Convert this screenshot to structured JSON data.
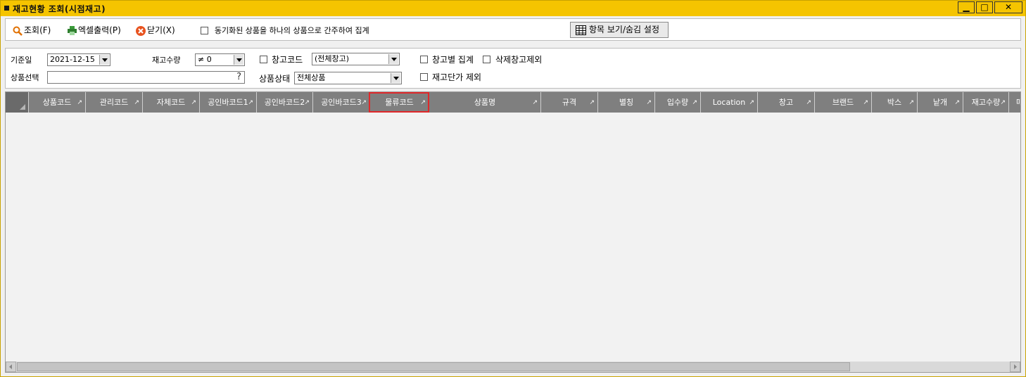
{
  "window": {
    "title": "재고현황 조회(시점재고)",
    "buttons": {
      "minimize": "▁",
      "maximize": "□",
      "close": "✕"
    },
    "accent_color": "#f5c400"
  },
  "toolbar": {
    "search_label": "조회(F)",
    "excel_label": "엑셀출력(P)",
    "close_label": "닫기(X)",
    "aggregate_checkbox_label": "동기화된 상품을 하나의 상품으로 간주하여 집계",
    "column_setting_label": "항목 보기/숨김 설정"
  },
  "filters": {
    "base_date_label": "기준일",
    "base_date_value": "2021-12-15",
    "stock_qty_label": "재고수량",
    "stock_qty_value": "≠ 0",
    "warehouse_code_label": "창고코드",
    "warehouse_code_value": "(전체창고)",
    "by_warehouse_label": "창고별 집계",
    "exclude_deleted_label": "삭제창고제외",
    "product_select_label": "상품선택",
    "product_select_value": "",
    "product_select_help": "?",
    "product_status_label": "상품상태",
    "product_status_value": "전체상품",
    "exclude_unit_cost_label": "재고단가 제외"
  },
  "grid": {
    "columns": [
      "상품코드",
      "관리코드",
      "자체코드",
      "공인바코드1",
      "공인바코드2",
      "공인바코드3",
      "물류코드",
      "상품명",
      "규격",
      "별칭",
      "입수량",
      "Location",
      "창고",
      "브랜드",
      "박스",
      "낱개",
      "재고수량",
      "매"
    ],
    "sort_indicator": "↗",
    "rows": []
  }
}
